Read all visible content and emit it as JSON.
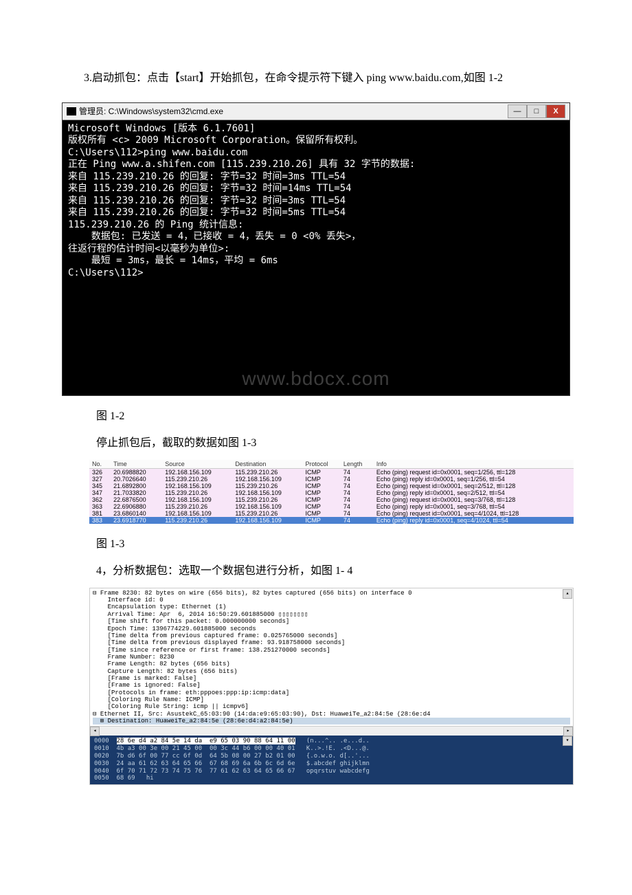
{
  "body_text": {
    "p1": "3.启动抓包：点击【start】开始抓包，在命令提示符下键入 ping www.baidu.com,如图 1-2",
    "cap1": "图 1-2",
    "p2": "停止抓包后，截取的数据如图 1-3",
    "cap2": "图 1-3",
    "p3": "4，分析数据包：选取一个数据包进行分析，如图 1- 4"
  },
  "cmd": {
    "title": "管理员: C:\\Windows\\system32\\cmd.exe",
    "lines": [
      "Microsoft Windows [版本 6.1.7601]",
      "版权所有 <c> 2009 Microsoft Corporation。保留所有权利。",
      "",
      "C:\\Users\\112>ping www.baidu.com",
      "",
      "正在 Ping www.a.shifen.com [115.239.210.26] 具有 32 字节的数据:",
      "来自 115.239.210.26 的回复: 字节=32 时间=3ms TTL=54",
      "来自 115.239.210.26 的回复: 字节=32 时间=14ms TTL=54",
      "来自 115.239.210.26 的回复: 字节=32 时间=3ms TTL=54",
      "来自 115.239.210.26 的回复: 字节=32 时间=5ms TTL=54",
      "",
      "115.239.210.26 的 Ping 统计信息:",
      "    数据包: 已发送 = 4，已接收 = 4，丢失 = 0 <0% 丢失>，",
      "往返行程的估计时间<以毫秒为单位>:",
      "    最短 = 3ms，最长 = 14ms，平均 = 6ms",
      "",
      "C:\\Users\\112>"
    ],
    "watermark": "www.bdocx.com"
  },
  "packet_headers": [
    "No.",
    "Time",
    "Source",
    "Destination",
    "Protocol",
    "Length",
    "Info"
  ],
  "packets": [
    {
      "no": "326",
      "time": "20.6988820",
      "src": "192.168.156.109",
      "dst": "115.239.210.26",
      "proto": "ICMP",
      "len": "74",
      "info": "Echo (ping) request  id=0x0001, seq=1/256, ttl=128",
      "cls": "req"
    },
    {
      "no": "327",
      "time": "20.7026640",
      "src": "115.239.210.26",
      "dst": "192.168.156.109",
      "proto": "ICMP",
      "len": "74",
      "info": "Echo (ping) reply    id=0x0001, seq=1/256, ttl=54",
      "cls": "rep"
    },
    {
      "no": "345",
      "time": "21.6892800",
      "src": "192.168.156.109",
      "dst": "115.239.210.26",
      "proto": "ICMP",
      "len": "74",
      "info": "Echo (ping) request  id=0x0001, seq=2/512, ttl=128",
      "cls": "req"
    },
    {
      "no": "347",
      "time": "21.7033820",
      "src": "115.239.210.26",
      "dst": "192.168.156.109",
      "proto": "ICMP",
      "len": "74",
      "info": "Echo (ping) reply    id=0x0001, seq=2/512, ttl=54",
      "cls": "rep"
    },
    {
      "no": "362",
      "time": "22.6876500",
      "src": "192.168.156.109",
      "dst": "115.239.210.26",
      "proto": "ICMP",
      "len": "74",
      "info": "Echo (ping) request  id=0x0001, seq=3/768, ttl=128",
      "cls": "req"
    },
    {
      "no": "363",
      "time": "22.6906880",
      "src": "115.239.210.26",
      "dst": "192.168.156.109",
      "proto": "ICMP",
      "len": "74",
      "info": "Echo (ping) reply    id=0x0001, seq=3/768, ttl=54",
      "cls": "rep"
    },
    {
      "no": "381",
      "time": "23.6860140",
      "src": "192.168.156.109",
      "dst": "115.239.210.26",
      "proto": "ICMP",
      "len": "74",
      "info": "Echo (ping) request  id=0x0001, seq=4/1024, ttl=128",
      "cls": "req"
    },
    {
      "no": "383",
      "time": "23.6918770",
      "src": "115.239.210.26",
      "dst": "192.168.156.109",
      "proto": "ICMP",
      "len": "74",
      "info": "Echo (ping) reply    id=0x0001, seq=4/1024, ttl=54",
      "cls": "sel"
    }
  ],
  "detail": {
    "lines": [
      "⊟ Frame 8230: 82 bytes on wire (656 bits), 82 bytes captured (656 bits) on interface 0",
      "    Interface id: 0",
      "    Encapsulation type: Ethernet (1)",
      "    Arrival Time: Apr  6, 2014 16:50:29.601885000 ▯▯▯▯▯▯▯▯",
      "    [Time shift for this packet: 0.000000000 seconds]",
      "    Epoch Time: 1396774229.601885000 seconds",
      "    [Time delta from previous captured frame: 0.025765000 seconds]",
      "    [Time delta from previous displayed frame: 93.918758000 seconds]",
      "    [Time since reference or first frame: 138.251270000 seconds]",
      "    Frame Number: 8230",
      "    Frame Length: 82 bytes (656 bits)",
      "    Capture Length: 82 bytes (656 bits)",
      "    [Frame is marked: False]",
      "    [Frame is ignored: False]",
      "    [Protocols in frame: eth:pppoes:ppp:ip:icmp:data]",
      "    [Coloring Rule Name: ICMP]",
      "    [Coloring Rule String: icmp || icmpv6]",
      "⊟ Ethernet II, Src: AsustekC_65:03:90 (14:da:e9:65:03:90), Dst: HuaweiTe_a2:84:5e (28:6e:d4",
      "  ⊞ Destination: HuaweiTe_a2:84:5e (28:6e:d4:a2:84:5e)"
    ],
    "hex": [
      {
        "off": "0000",
        "b": "28 6e d4 a2 84 5e 14 da  e9 65 03 90 88 64 11 00",
        "a": "(n...^.. .e...d.."
      },
      {
        "off": "0010",
        "b": "4b a3 00 3e 00 21 45 00  00 3c 44 b6 00 00 40 01",
        "a": "K..>.!E. .<D...@."
      },
      {
        "off": "0020",
        "b": "7b d6 6f 00 77 cc 6f 0d  64 5b 08 00 27 b2 01 00",
        "a": "{.o.w.o. d[..'..."
      },
      {
        "off": "0030",
        "b": "24 aa 61 62 63 64 65 66  67 68 69 6a 6b 6c 6d 6e",
        "a": "$.abcdef ghijklmn"
      },
      {
        "off": "0040",
        "b": "6f 70 71 72 73 74 75 76  77 61 62 63 64 65 66 67",
        "a": "opqrstuv wabcdefg"
      },
      {
        "off": "0050",
        "b": "68 69",
        "a": "hi"
      }
    ]
  }
}
